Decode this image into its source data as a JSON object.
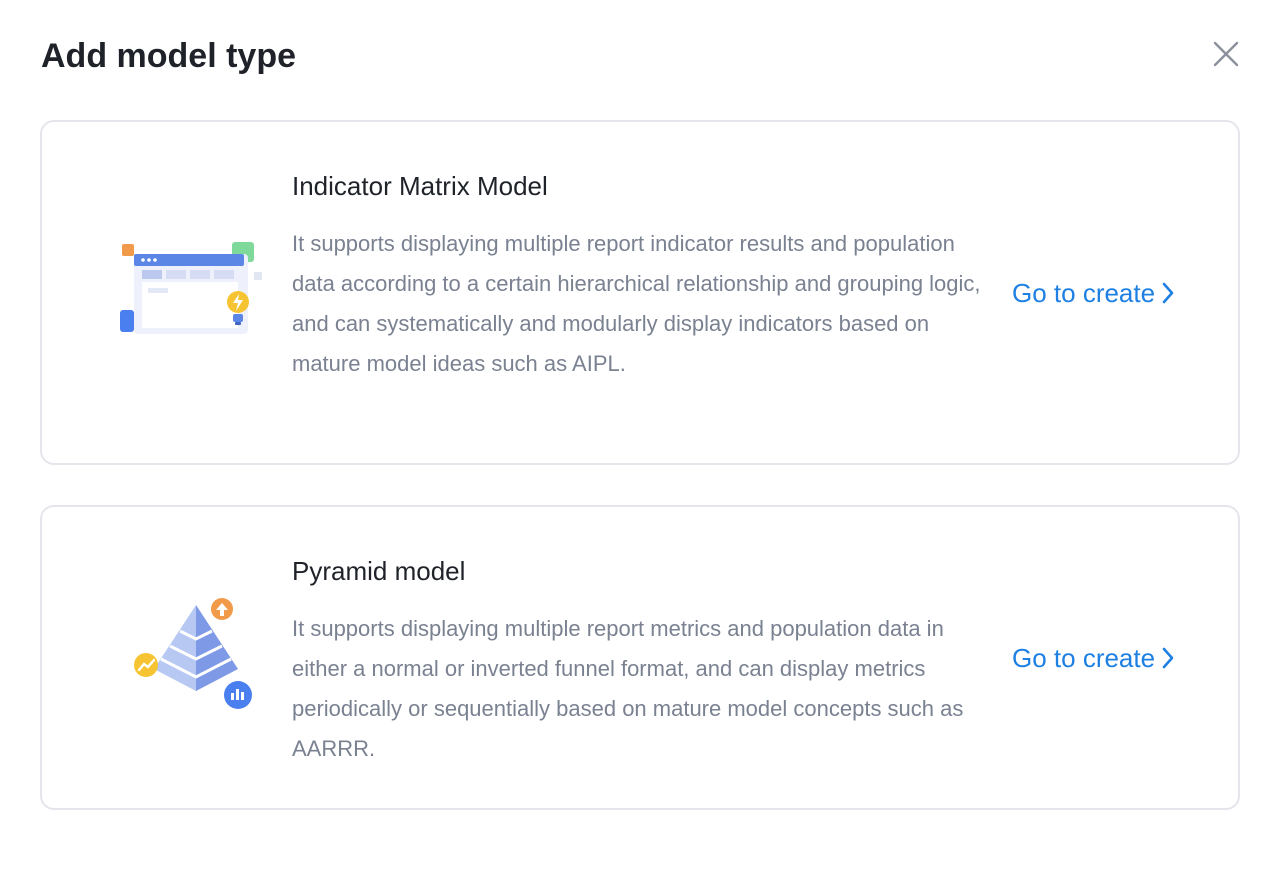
{
  "modal": {
    "title": "Add model type",
    "close_icon": "close-icon"
  },
  "cards": [
    {
      "title": "Indicator Matrix Model",
      "description": "It supports displaying multiple report indicator results and population data according to a certain hierarchical relationship and grouping logic, and can systematically and modularly display indicators based on mature model ideas such as AIPL.",
      "cta_label": "Go to create",
      "icon": "matrix-dashboard-illustration"
    },
    {
      "title": "Pyramid model",
      "description": "It supports displaying multiple report metrics and population data in either a normal or inverted funnel format, and can display metrics periodically or sequentially based on mature model concepts such as AARRR.",
      "cta_label": "Go to create",
      "icon": "pyramid-illustration"
    }
  ],
  "colors": {
    "accent": "#1e80e3",
    "title_text": "#1f2329",
    "body_text": "#7a8191",
    "border": "#e4e6eb"
  }
}
